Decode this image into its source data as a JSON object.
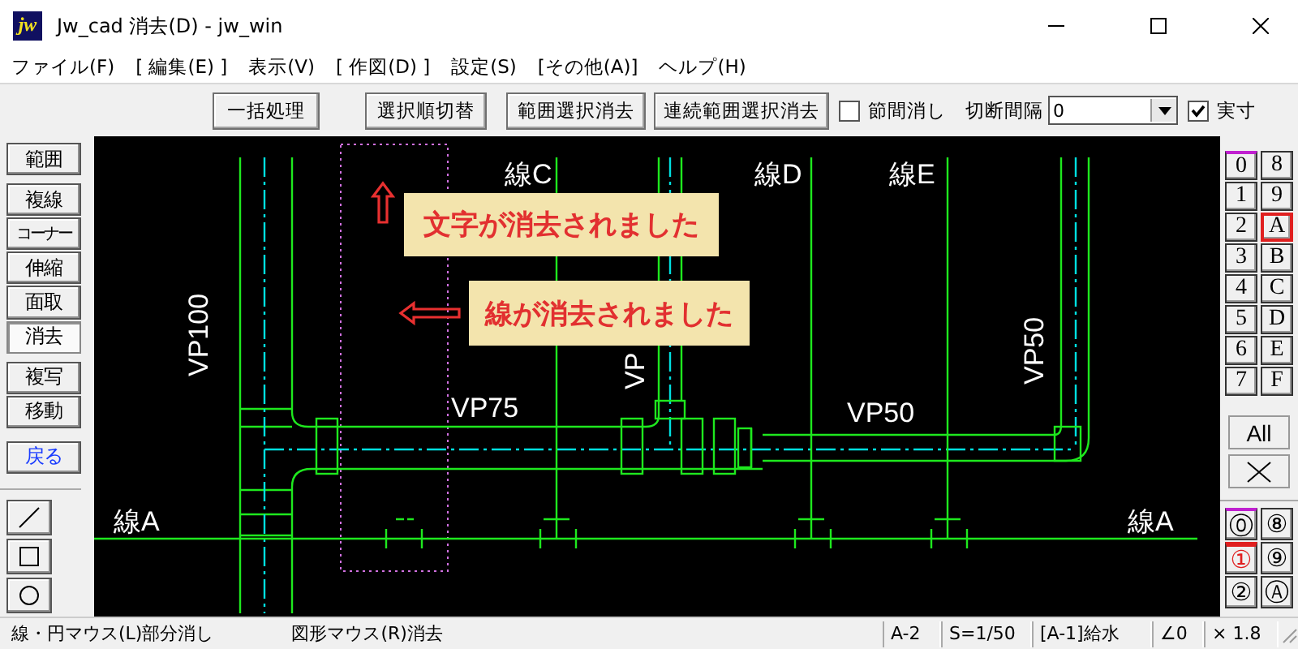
{
  "window": {
    "icon_text": "jw",
    "title": "Jw_cad 消去(D) - jw_win"
  },
  "menu": [
    "ファイル(F)",
    "[ 編集(E) ]",
    "表示(V)",
    "[ 作図(D) ]",
    "設定(S)",
    "[その他(A)]",
    "ヘルプ(H)"
  ],
  "toolbar": {
    "buttons": [
      "一括処理",
      "選択順切替",
      "範囲選択消去",
      "連続範囲選択消去"
    ],
    "options": [
      {
        "kind": "checkbox",
        "label": "節間消し",
        "checked": false
      },
      {
        "kind": "combo",
        "label": "切断間隔",
        "value": "0"
      },
      {
        "kind": "checkbox",
        "label": "実寸",
        "checked": true
      }
    ]
  },
  "left_tools": [
    {
      "label": "範囲",
      "kind": "tool",
      "selected": false
    },
    {
      "label": "複線",
      "kind": "tool",
      "selected": false
    },
    {
      "label": "コーナー",
      "kind": "tool",
      "selected": false
    },
    {
      "label": "伸縮",
      "kind": "tool",
      "selected": false
    },
    {
      "label": "面取",
      "kind": "tool",
      "selected": false
    },
    {
      "label": "消去",
      "kind": "tool",
      "selected": true
    },
    {
      "label": "複写",
      "kind": "tool",
      "selected": false
    },
    {
      "label": "移動",
      "kind": "tool",
      "selected": false
    },
    {
      "label": "戻る",
      "kind": "undo",
      "selected": false
    }
  ],
  "shape_tools": [
    {
      "kind": "line"
    },
    {
      "kind": "rect"
    },
    {
      "kind": "circle"
    }
  ],
  "drawing": {
    "labels": [
      "線C",
      "線D",
      "線E",
      "VP100",
      "VP",
      "VP50",
      "VP75",
      "VP50",
      "線A",
      "線A"
    ],
    "callouts": [
      "文字が消去されました",
      "線が消去されました"
    ]
  },
  "layers": [
    {
      "label": "0",
      "selected": false,
      "marked": true
    },
    {
      "label": "8",
      "selected": false,
      "marked": false
    },
    {
      "label": "1",
      "selected": false,
      "marked": false
    },
    {
      "label": "9",
      "selected": false,
      "marked": false
    },
    {
      "label": "2",
      "selected": false,
      "marked": false
    },
    {
      "label": "A",
      "selected": true,
      "marked": false
    },
    {
      "label": "3",
      "selected": false,
      "marked": false
    },
    {
      "label": "B",
      "selected": false,
      "marked": false
    },
    {
      "label": "4",
      "selected": false,
      "marked": false
    },
    {
      "label": "C",
      "selected": false,
      "marked": false
    },
    {
      "label": "5",
      "selected": false,
      "marked": false
    },
    {
      "label": "D",
      "selected": false,
      "marked": false
    },
    {
      "label": "6",
      "selected": false,
      "marked": false
    },
    {
      "label": "E",
      "selected": false,
      "marked": false
    },
    {
      "label": "7",
      "selected": false,
      "marked": false
    },
    {
      "label": "F",
      "selected": false,
      "marked": false
    }
  ],
  "layer_all": "All",
  "layer_groups": [
    {
      "label": "⓪",
      "selected": false,
      "marked": true
    },
    {
      "label": "⑧",
      "selected": false,
      "marked": false
    },
    {
      "label": "①",
      "selected": true,
      "marked": false
    },
    {
      "label": "⑨",
      "selected": false,
      "marked": false
    },
    {
      "label": "②",
      "selected": false,
      "marked": false
    },
    {
      "label": "Ⓐ",
      "selected": false,
      "marked": false
    }
  ],
  "status_bar": {
    "left_hint": "線・円マウス(L)部分消し",
    "right_hint": "図形マウス(R)消去",
    "fields": [
      "A-2",
      "S=1/50",
      "[A-1]給水",
      "∠0",
      "× 1.8"
    ]
  }
}
